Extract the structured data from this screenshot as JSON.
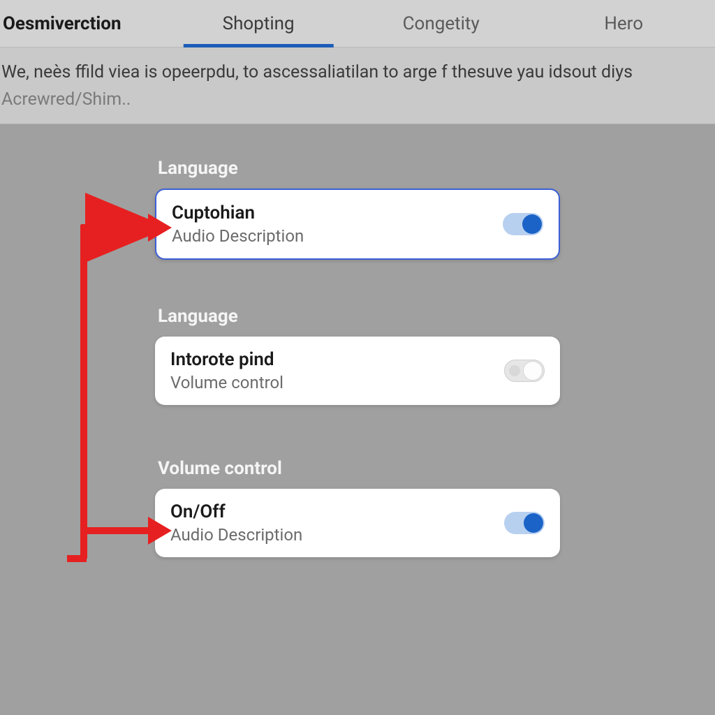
{
  "tabs": {
    "items": [
      {
        "label": "Oesmiverction"
      },
      {
        "label": "Shopting"
      },
      {
        "label": "Congetity"
      },
      {
        "label": "Hero"
      }
    ],
    "active_index": 1
  },
  "description": {
    "line1": "We, neès ffild viea is opeerpdu, to ascessaliatilan to arge f thesuve yau idsout diys",
    "line2": "Acrewred/Shim.."
  },
  "sections": [
    {
      "heading": "Language",
      "card": {
        "title": "Cuptohian",
        "subtitle": "Audio Description",
        "toggle_on": true,
        "highlighted": true
      }
    },
    {
      "heading": "Language",
      "card": {
        "title": "Intorote pind",
        "subtitle": "Volume control",
        "toggle_on": false,
        "highlighted": false
      }
    },
    {
      "heading": "Volume control",
      "card": {
        "title": "On/Off",
        "subtitle": "Audio Description",
        "toggle_on": true,
        "highlighted": false
      }
    }
  ],
  "colors": {
    "accent": "#1c63c8",
    "arrow": "#e62020"
  }
}
